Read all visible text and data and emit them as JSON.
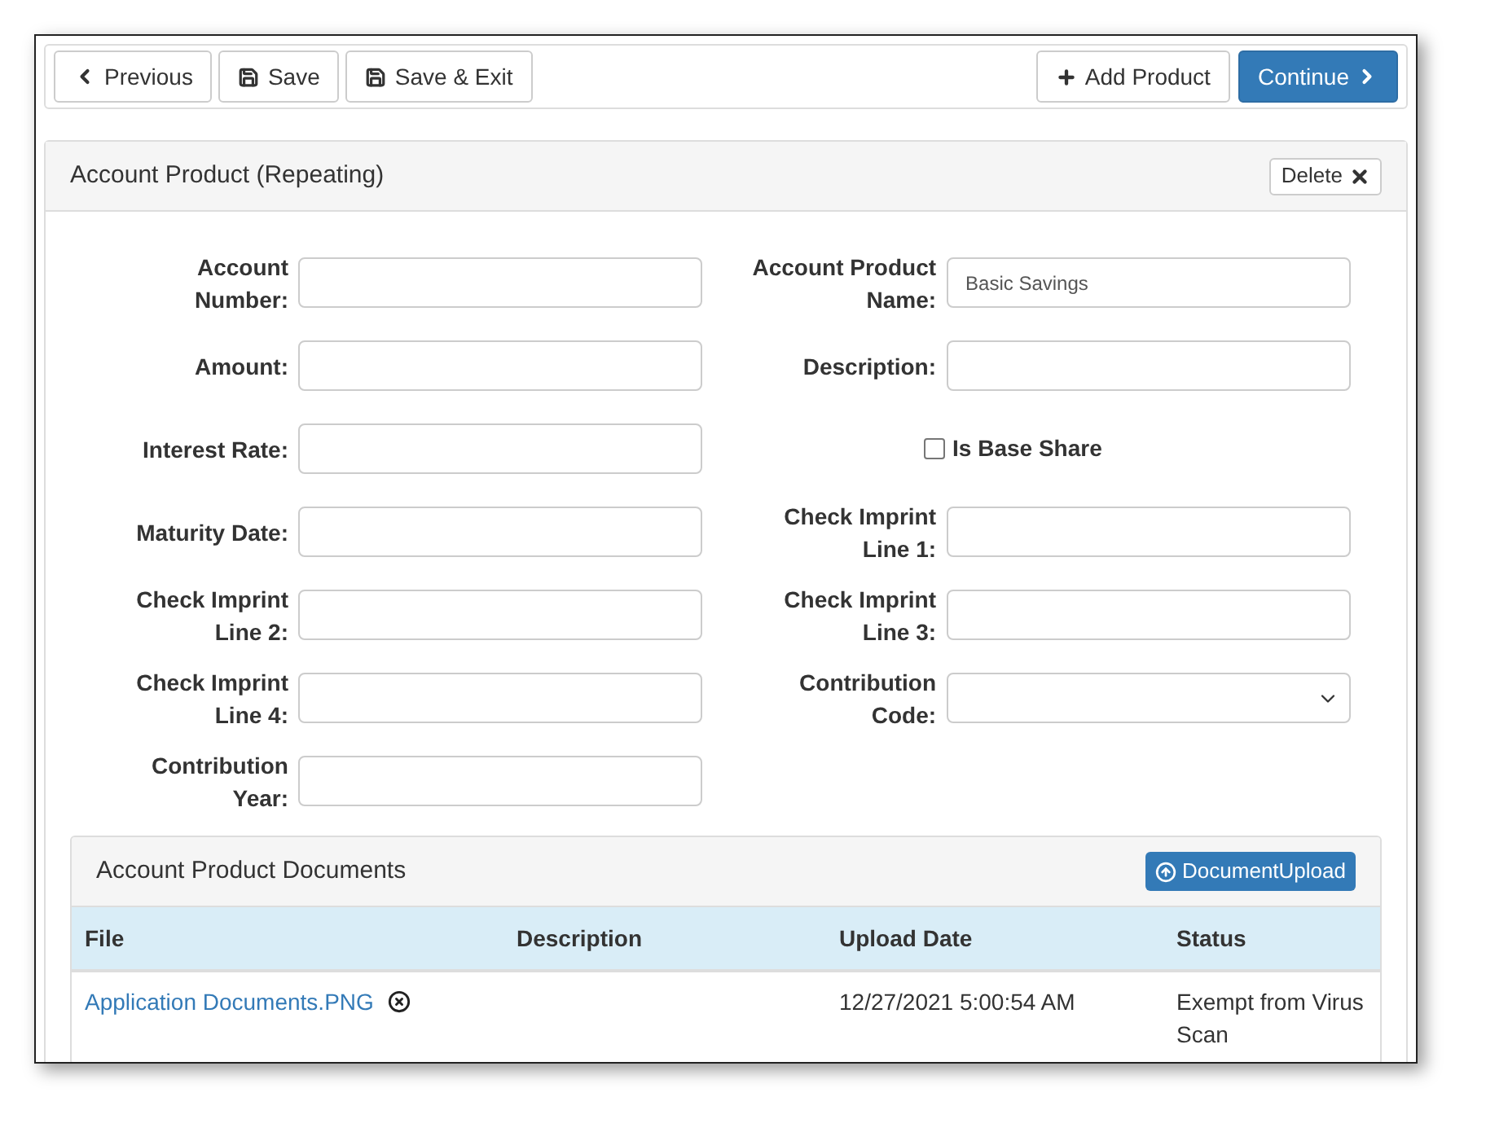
{
  "toolbar": {
    "left_buttons": [
      "Previous",
      "Save",
      "Save & Exit"
    ],
    "add_button": "Add Product",
    "continue_button": "Continue"
  },
  "panel": {
    "title": "Account Product (Repeating)",
    "delete_button": "Delete",
    "left_fields": [
      {
        "kind": "text",
        "label": "Account\nNumber:"
      },
      {
        "kind": "text",
        "label": "Amount:"
      },
      {
        "kind": "text",
        "label": "Interest Rate:"
      },
      {
        "kind": "text",
        "label": "Maturity Date:"
      },
      {
        "kind": "text",
        "label": "Check Imprint\nLine 2:"
      },
      {
        "kind": "text",
        "label": "Check Imprint\nLine 4:"
      },
      {
        "kind": "text",
        "label": "Contribution\nYear:"
      }
    ],
    "right_fields": [
      {
        "kind": "text",
        "label": "Account Product\nName:",
        "value": "Basic Savings"
      },
      {
        "kind": "text",
        "label": "Description:"
      },
      {
        "kind": "checkbox",
        "label": "Is Base Share",
        "checked": false
      },
      {
        "kind": "text",
        "label": "Check Imprint\nLine 1:"
      },
      {
        "kind": "text",
        "label": "Check Imprint\nLine 3:"
      },
      {
        "kind": "select",
        "label": "Contribution\nCode:"
      }
    ],
    "documents": {
      "title": "Account Product Documents",
      "upload_button": "DocumentUpload",
      "columns": [
        "File",
        "Description",
        "Upload Date",
        "Status"
      ],
      "rows": [
        {
          "file": "Application Documents.PNG",
          "upload_date": "12/27/2021 5:00:54 AM",
          "status": "Exempt from Virus Scan"
        }
      ]
    }
  }
}
